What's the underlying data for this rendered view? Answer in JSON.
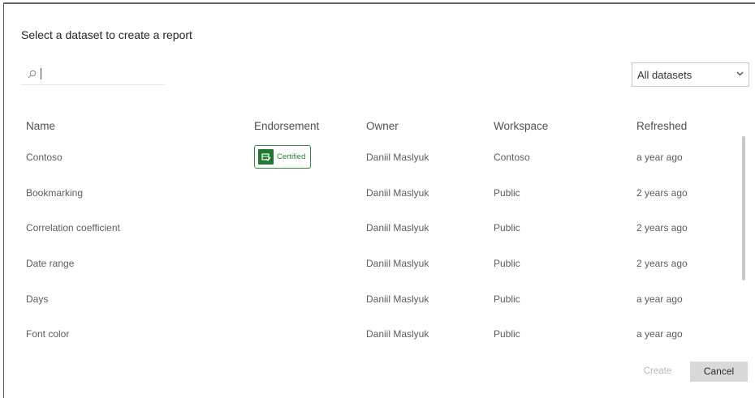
{
  "dialog": {
    "title": "Select a dataset to create a report"
  },
  "search": {
    "value": "",
    "placeholder": ""
  },
  "filter": {
    "selected": "All datasets"
  },
  "table": {
    "headers": {
      "name": "Name",
      "endorsement": "Endorsement",
      "owner": "Owner",
      "workspace": "Workspace",
      "refreshed": "Refreshed"
    },
    "rows": [
      {
        "name": "Contoso",
        "endorsement": "Certified",
        "owner": "Daniil Maslyuk",
        "workspace": "Contoso",
        "refreshed": "a year ago"
      },
      {
        "name": "Bookmarking",
        "endorsement": "",
        "owner": "Daniil Maslyuk",
        "workspace": "Public",
        "refreshed": "2 years ago"
      },
      {
        "name": "Correlation coefficient",
        "endorsement": "",
        "owner": "Daniil Maslyuk",
        "workspace": "Public",
        "refreshed": "2 years ago"
      },
      {
        "name": "Date range",
        "endorsement": "",
        "owner": "Daniil Maslyuk",
        "workspace": "Public",
        "refreshed": "2 years ago"
      },
      {
        "name": "Days",
        "endorsement": "",
        "owner": "Daniil Maslyuk",
        "workspace": "Public",
        "refreshed": "a year ago"
      },
      {
        "name": "Font color",
        "endorsement": "",
        "owner": "Daniil Maslyuk",
        "workspace": "Public",
        "refreshed": "a year ago"
      }
    ]
  },
  "footer": {
    "create_label": "Create",
    "cancel_label": "Cancel"
  },
  "colors": {
    "certified_green": "#1f7a2e",
    "cancel_bg": "#d9d9d9",
    "disabled_text": "#b7b7b7"
  },
  "icons": {
    "search": "search-icon",
    "dropdown": "chevron-down-icon",
    "certified": "certified-icon"
  }
}
